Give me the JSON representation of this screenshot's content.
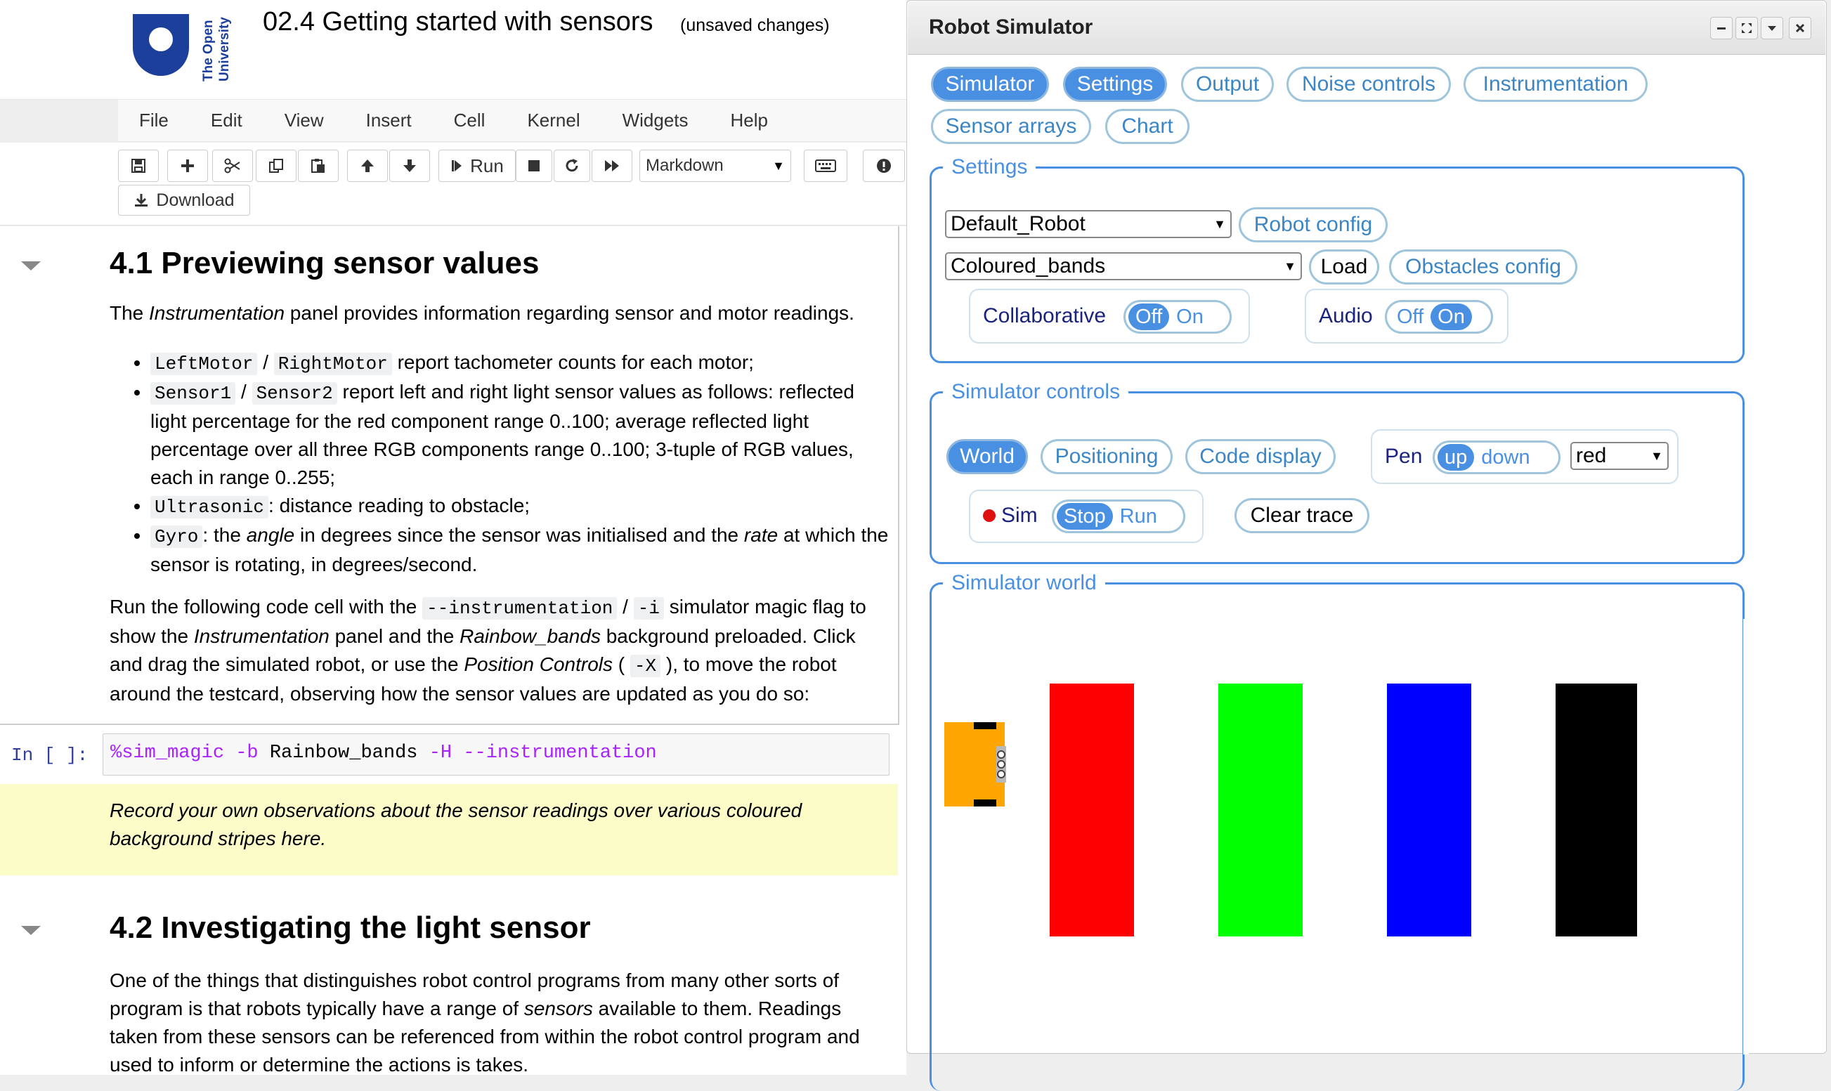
{
  "notebook": {
    "logo_text": "The Open University",
    "title": "02.4 Getting started with sensors",
    "status": "(unsaved changes)",
    "menu": [
      "File",
      "Edit",
      "View",
      "Insert",
      "Cell",
      "Kernel",
      "Widgets",
      "Help"
    ],
    "toolbar": {
      "run_label": "Run",
      "cell_type": "Markdown",
      "download_label": "Download"
    },
    "section1": {
      "heading": "4.1 Previewing sensor values",
      "intro_pre": "The ",
      "intro_em": "Instrumentation",
      "intro_post": " panel provides information regarding sensor and motor readings.",
      "b1_code1": "LeftMotor",
      "b1_sep": " / ",
      "b1_code2": "RightMotor",
      "b1_text": " report tachometer counts for each motor;",
      "b2_code1": "Sensor1",
      "b2_sep": " / ",
      "b2_code2": "Sensor2",
      "b2_text": " report left and right light sensor values as follows: reflected light percentage for the red component range 0..100; average reflected light percentage over all three RGB components range 0..100; 3-tuple of RGB values, each in range 0..255;",
      "b3_code": "Ultrasonic",
      "b3_text": ": distance reading to obstacle;",
      "b4_code": "Gyro",
      "b4_t1": ": the ",
      "b4_em1": "angle",
      "b4_t2": " in degrees since the sensor was initialised and the ",
      "b4_em2": "rate",
      "b4_t3": " at which the sensor is rotating, in degrees/second.",
      "p2_t1": "Run the following code cell with the ",
      "p2_code1": "--instrumentation",
      "p2_t2": " / ",
      "p2_code2": "-i",
      "p2_t3": " simulator magic flag to show the ",
      "p2_em1": "Instrumentation",
      "p2_t4": " panel and the ",
      "p2_em2": "Rainbow_bands",
      "p2_t5": " background preloaded. Click and drag the simulated robot, or use the ",
      "p2_em3": "Position Controls",
      "p2_t6": " ( ",
      "p2_code3": "-X",
      "p2_t7": " ), to move the robot around the testcard, observing how the sensor values are updated as you do so:"
    },
    "code_cell": {
      "prompt": "In [ ]:",
      "magic": "%sim_magic",
      "flag_b": "-b",
      "arg_b": "Rainbow_bands",
      "flag_h": "-H",
      "flag_i": "--instrumentation"
    },
    "observation": "Record your own observations about the sensor readings over various coloured background stripes here.",
    "section2": {
      "heading": "4.2 Investigating the light sensor",
      "p_t1": "One of the things that distinguishes robot control programs from many other sorts of program is that robots typically have a range of ",
      "p_em": "sensors",
      "p_t2": " available to them. Readings taken from these sensors can be referenced from within the robot control program and used to inform or determine the actions is takes."
    }
  },
  "simulator": {
    "title": "Robot Simulator",
    "tabs": [
      {
        "label": "Simulator",
        "active": true
      },
      {
        "label": "Settings",
        "active": true
      },
      {
        "label": "Output",
        "active": false
      },
      {
        "label": "Noise controls",
        "active": false
      },
      {
        "label": "Instrumentation",
        "active": false
      },
      {
        "label": "Sensor arrays",
        "active": false
      },
      {
        "label": "Chart",
        "active": false
      }
    ],
    "settings": {
      "legend": "Settings",
      "robot_select": "Default_Robot",
      "robot_config": "Robot config",
      "background_select": "Coloured_bands",
      "load": "Load",
      "obstacles_config": "Obstacles config",
      "collaborative_label": "Collaborative",
      "collaborative_off": "Off",
      "collaborative_on": "On",
      "collaborative_state": "Off",
      "audio_label": "Audio",
      "audio_off": "Off",
      "audio_on": "On",
      "audio_state": "On"
    },
    "controls": {
      "legend": "Simulator controls",
      "world": "World",
      "positioning": "Positioning",
      "code_display": "Code display",
      "pen_label": "Pen",
      "pen_up": "up",
      "pen_down": "down",
      "pen_state": "up",
      "pen_color": "red",
      "sim_label": "Sim",
      "sim_stop": "Stop",
      "sim_run": "Run",
      "sim_state": "Stop",
      "clear_trace": "Clear trace"
    },
    "world": {
      "legend": "Simulator world",
      "bands": [
        "#ff0000",
        "#00ff00",
        "#0000ff",
        "#000000"
      ],
      "robot_color": "#ffa500"
    }
  },
  "colors": {
    "accent": "#4a90e2",
    "ou_blue": "#1b3f9b"
  }
}
